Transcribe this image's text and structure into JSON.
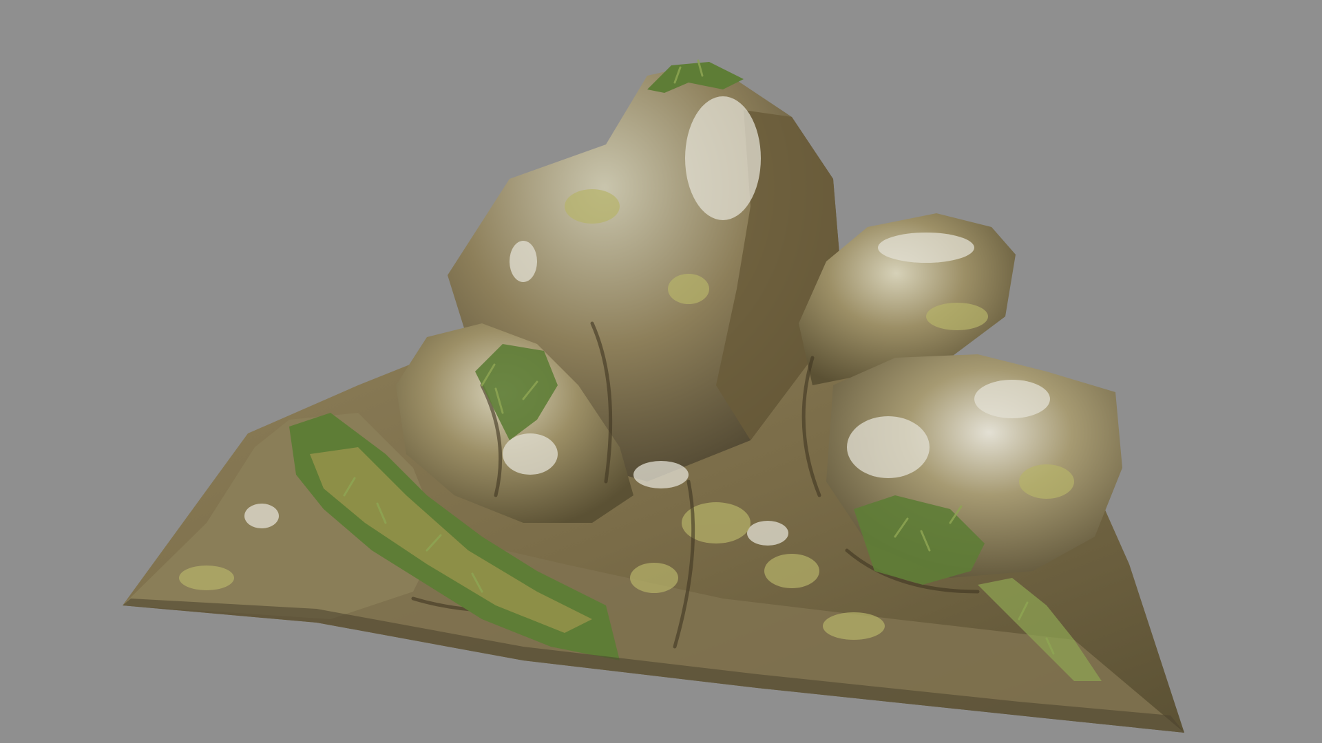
{
  "scene": {
    "background_color": "#8f8f8f",
    "subject": "moss-covered-rock-formation",
    "colors": {
      "rock_dark": "#5b5134",
      "rock_mid": "#8d7f5a",
      "rock_light": "#c8c2a6",
      "highlight": "#e3e0d4",
      "lichen": "#b7b36a",
      "moss": "#5e7d36",
      "moss_light": "#8ea553",
      "grass_dry": "#b59e55"
    }
  }
}
